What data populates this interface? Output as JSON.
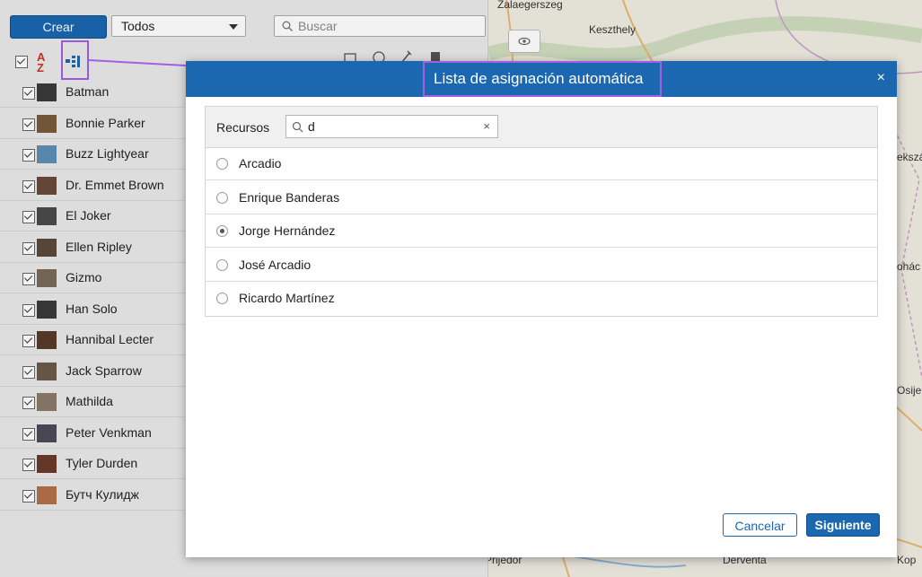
{
  "toolbar": {
    "create_label": "Crear",
    "filter_value": "Todos",
    "search_placeholder": "Buscar"
  },
  "resources_list": [
    {
      "name": "Batman",
      "checked": true
    },
    {
      "name": "Bonnie Parker",
      "checked": true
    },
    {
      "name": "Buzz Lightyear",
      "checked": true
    },
    {
      "name": "Dr. Emmet Brown",
      "checked": true
    },
    {
      "name": "El Joker",
      "checked": true
    },
    {
      "name": "Ellen Ripley",
      "checked": true
    },
    {
      "name": "Gizmo",
      "checked": true
    },
    {
      "name": "Han Solo",
      "checked": true
    },
    {
      "name": "Hannibal Lecter",
      "checked": true
    },
    {
      "name": "Jack Sparrow",
      "checked": true
    },
    {
      "name": "Mathilda",
      "checked": true
    },
    {
      "name": "Peter Venkman",
      "checked": true
    },
    {
      "name": "Tyler Durden",
      "checked": true
    },
    {
      "name": "Бутч Кулидж",
      "checked": true
    }
  ],
  "map": {
    "labels": [
      "Zalaegerszeg",
      "Keszthely",
      "Prijedor",
      "Derventa",
      "Kop",
      "Osijek",
      "ohác",
      "ekszá"
    ]
  },
  "modal": {
    "title": "Lista de asignación automática",
    "close_glyph": "×",
    "resources_label": "Recursos",
    "search_value": "d",
    "clear_glyph": "×",
    "options": [
      {
        "name": "Arcadio",
        "selected": false
      },
      {
        "name": "Enrique Banderas",
        "selected": false
      },
      {
        "name": "Jorge Hernández",
        "selected": true
      },
      {
        "name": "José Arcadio",
        "selected": false
      },
      {
        "name": "Ricardo Martínez",
        "selected": false
      }
    ],
    "cancel_label": "Cancelar",
    "next_label": "Siguiente"
  },
  "colors": {
    "primary": "#1b67b0",
    "highlight": "#a35ee8"
  }
}
